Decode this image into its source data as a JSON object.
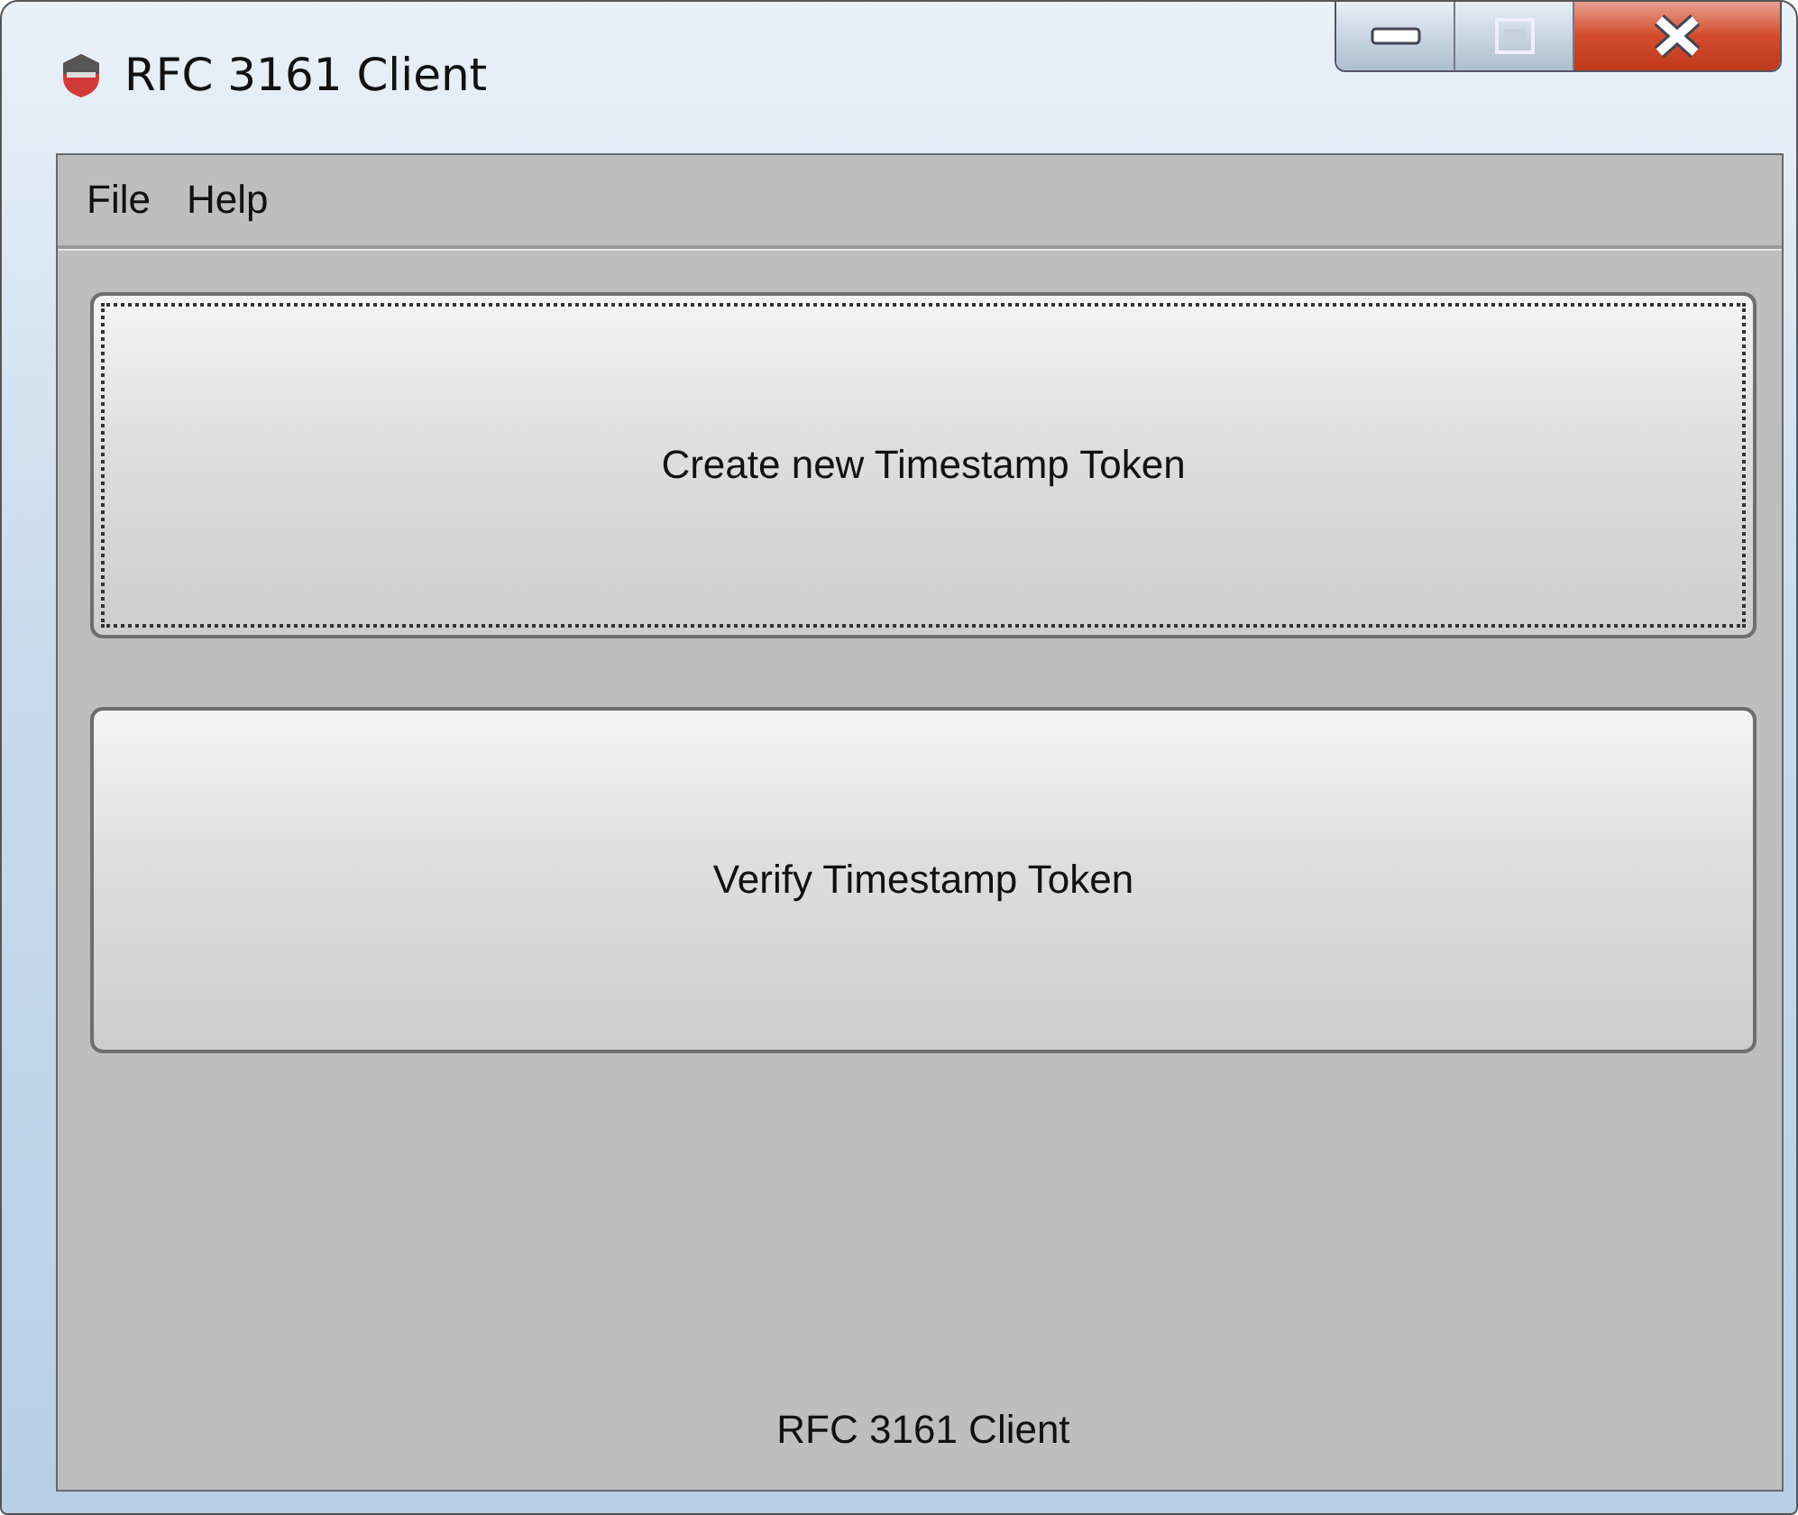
{
  "window": {
    "title": "RFC 3161 Client"
  },
  "menu": [
    "File",
    "Help"
  ],
  "buttons": [
    {
      "label": "Create new Timestamp Token",
      "focused": true
    },
    {
      "label": "Verify Timestamp Token",
      "focused": false
    }
  ],
  "status_bar": "RFC 3161 Client"
}
